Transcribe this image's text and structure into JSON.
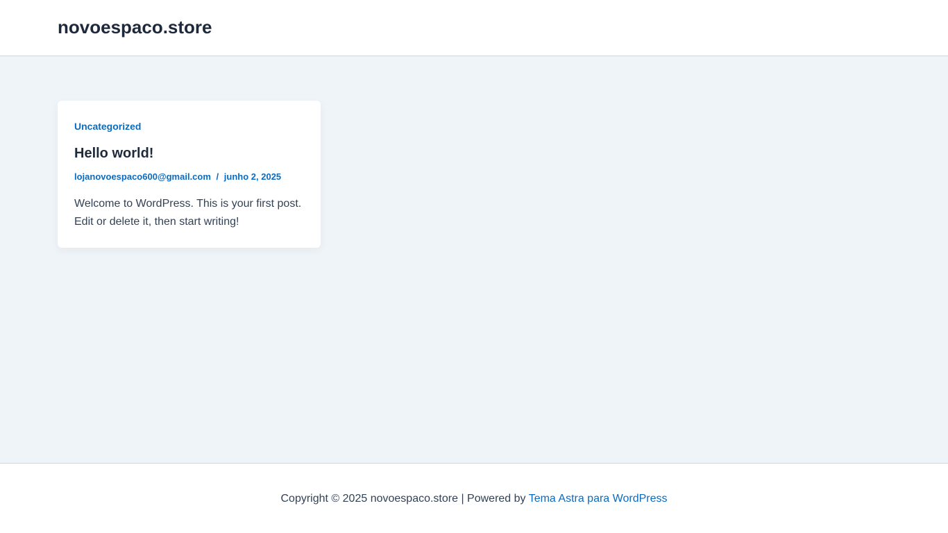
{
  "header": {
    "site_title": "novoespaco.store"
  },
  "post": {
    "category": "Uncategorized",
    "title": "Hello world!",
    "author": "lojanovoespaco600@gmail.com",
    "separator": "/",
    "date": "junho 2, 2025",
    "excerpt": "Welcome to WordPress. This is your first post. Edit or delete it, then start writing!"
  },
  "footer": {
    "copyright": "Copyright © 2025 novoespaco.store | Powered by ",
    "theme_link": "Tema Astra para WordPress"
  },
  "colors": {
    "accent": "#0b6bbf",
    "heading": "#1e293b",
    "body_text": "#334155",
    "content_bg": "#eff4f8"
  }
}
